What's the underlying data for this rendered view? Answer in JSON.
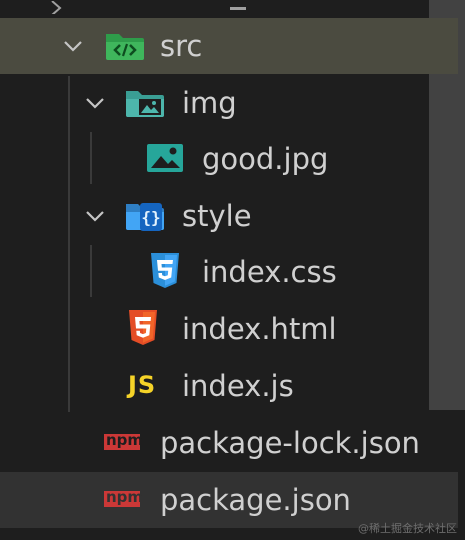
{
  "explorer": {
    "items": [
      {
        "name": "src",
        "type": "folder",
        "expanded": true,
        "selected": true
      },
      {
        "name": "img",
        "type": "folder",
        "expanded": true
      },
      {
        "name": "good.jpg",
        "type": "image"
      },
      {
        "name": "style",
        "type": "folder",
        "expanded": true
      },
      {
        "name": "index.css",
        "type": "css"
      },
      {
        "name": "index.html",
        "type": "html"
      },
      {
        "name": "index.js",
        "type": "js"
      },
      {
        "name": "package-lock.json",
        "type": "npm"
      },
      {
        "name": "package.json",
        "type": "npm",
        "hovered": true
      }
    ],
    "icon_text": {
      "js": "JS",
      "npm": "npm"
    },
    "icons": {
      "src": "folder-src-icon",
      "img": "folder-images-icon",
      "good.jpg": "image-file-icon",
      "style": "folder-css-icon",
      "index.css": "css3-file-icon",
      "index.html": "html5-file-icon",
      "index.js": "javascript-file-icon",
      "package-lock.json": "npm-file-icon",
      "package.json": "npm-file-icon"
    },
    "colors": {
      "background": "#1e1e1e",
      "selected_row": "#4b4b40",
      "hover_row": "#323232",
      "text": "#d0d0d0",
      "folder_green": "#2e9c4a",
      "folder_teal": "#4db6ac",
      "folder_blue": "#42a5f5",
      "css_blue": "#2b8fd9",
      "html_orange": "#e44d26",
      "js_yellow": "#f5d328",
      "npm_red": "#cb3837"
    }
  },
  "watermark": "@稀土掘金技术社区"
}
